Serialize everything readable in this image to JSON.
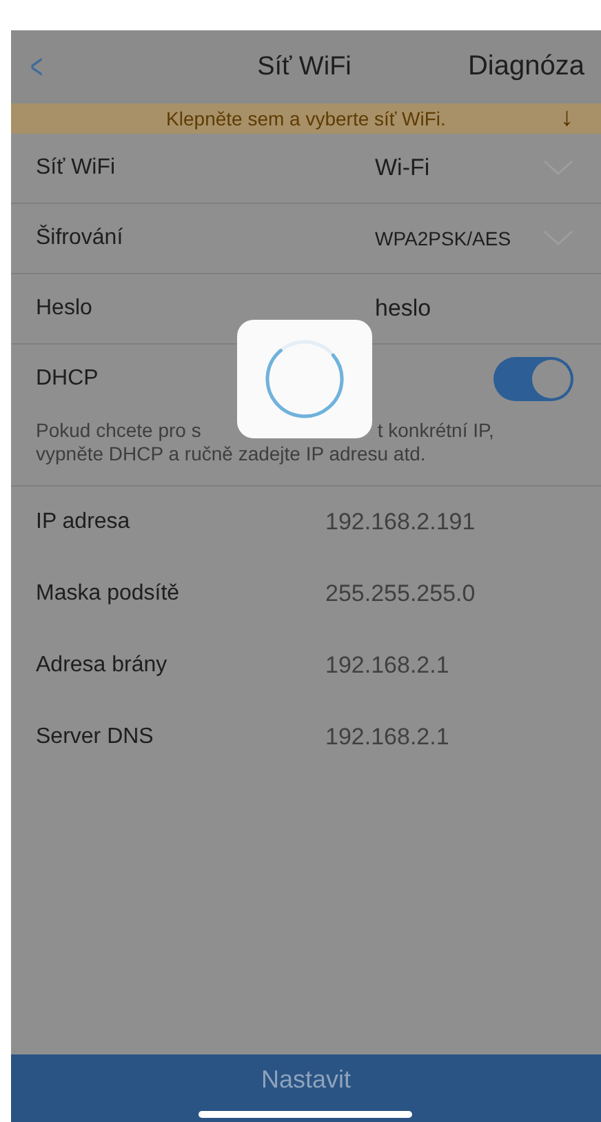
{
  "nav": {
    "back": "<",
    "title": "Síť WiFi",
    "action": "Diagnóza"
  },
  "banner": {
    "text": "Klepněte sem a vyberte síť WiFi.",
    "arrow": "↓"
  },
  "settings": [
    {
      "kind": "select",
      "label": "Síť WiFi",
      "value": "Wi-Fi"
    },
    {
      "kind": "select",
      "label": "Šifrování",
      "value": "WPA2PSK/AES"
    },
    {
      "kind": "input",
      "label": "Heslo",
      "value": "heslo"
    },
    {
      "kind": "toggle",
      "label": "DHCP",
      "on": true
    }
  ],
  "hint": {
    "line_1_start": "Pokud chcete pro s",
    "line_1_end": "t konkrétní IP,",
    "line_2": "vypněte DHCP a ručně zadejte IP adresu atd."
  },
  "network": [
    {
      "label": "IP adresa",
      "value": "192.168.2.191"
    },
    {
      "label": "Maska podsítě",
      "value": "255.255.255.0"
    },
    {
      "label": "Adresa brány",
      "value": "192.168.2.1"
    },
    {
      "label": "Server DNS",
      "value": "192.168.2.1"
    }
  ],
  "loading": true,
  "submit": "Nastavit"
}
